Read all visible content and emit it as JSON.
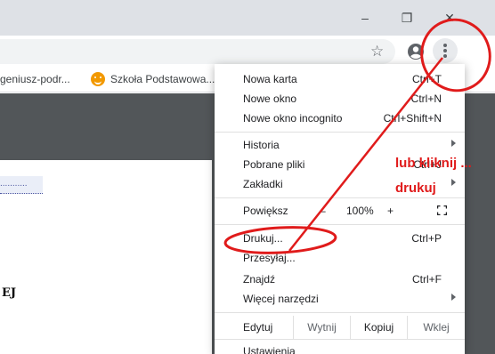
{
  "window": {
    "minimize_glyph": "–",
    "restore_glyph": "❐",
    "close_glyph": "✕"
  },
  "toolbar": {
    "star_glyph": "☆"
  },
  "bookmarks": [
    {
      "label": "geniusz-podr..."
    },
    {
      "label": "Szkoła Podstawowa..."
    }
  ],
  "document": {
    "field_text": "...........",
    "heading_fragment": "EJ"
  },
  "menu": {
    "items_top": [
      {
        "label": "Nowa karta",
        "shortcut": "Ctrl+T"
      },
      {
        "label": "Nowe okno",
        "shortcut": "Ctrl+N"
      },
      {
        "label": "Nowe okno incognito",
        "shortcut": "Ctrl+Shift+N"
      }
    ],
    "items_mid": [
      {
        "label": "Historia",
        "shortcut": "",
        "submenu": true
      },
      {
        "label": "Pobrane pliki",
        "shortcut": "Ctrl+J",
        "submenu": false
      },
      {
        "label": "Zakładki",
        "shortcut": "",
        "submenu": true
      }
    ],
    "zoom": {
      "label": "Powiększ",
      "minus": "–",
      "value": "100%",
      "plus": "+"
    },
    "items_print": [
      {
        "label": "Drukuj...",
        "shortcut": "Ctrl+P"
      },
      {
        "label": "Przesyłaj...",
        "shortcut": ""
      },
      {
        "label": "Znajdź",
        "shortcut": "Ctrl+F"
      },
      {
        "label": "Więcej narzędzi",
        "shortcut": "",
        "submenu": true
      }
    ],
    "edit": {
      "label": "Edytuj",
      "cut": "Wytnij",
      "copy": "Kopiuj",
      "paste": "Wklej"
    },
    "settings": {
      "label": "Ustawienia"
    }
  },
  "annotation": {
    "line1": "lub kliknij ...",
    "line2": "drukuj",
    "color": "#e01b1b"
  }
}
